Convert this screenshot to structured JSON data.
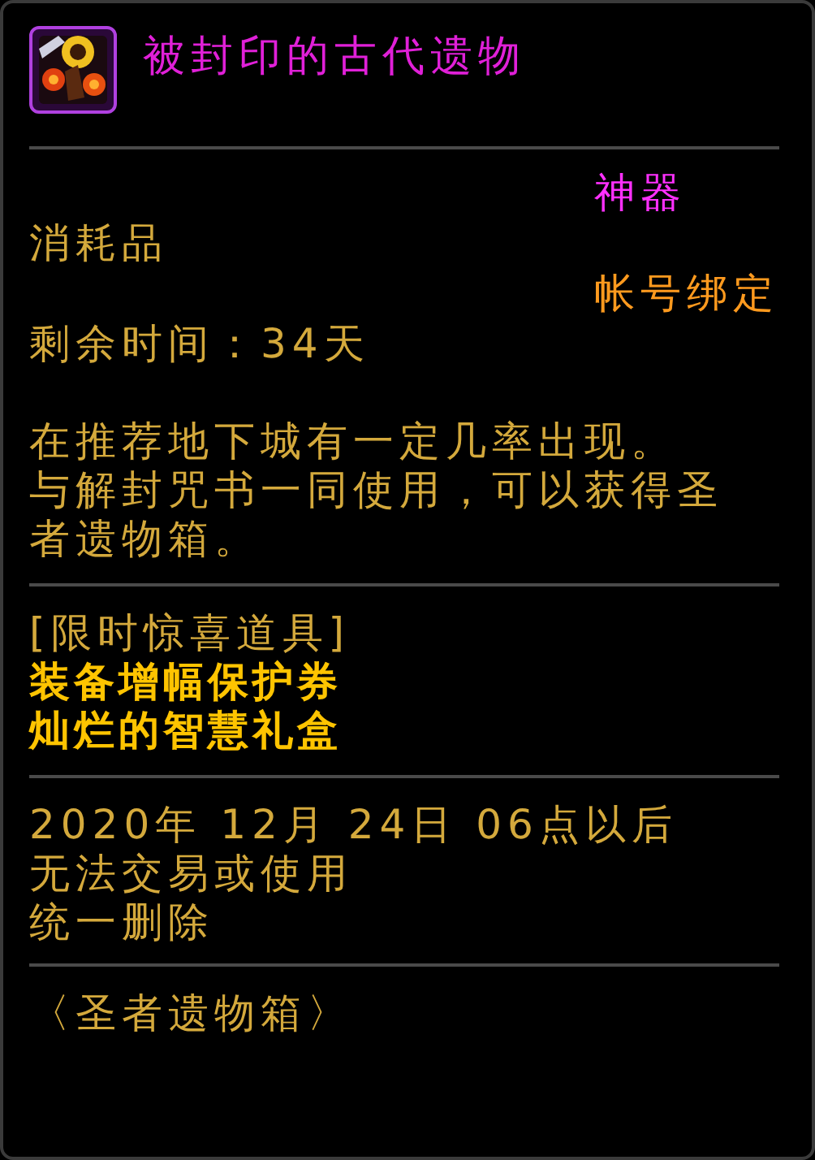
{
  "item": {
    "name": "被封印的古代遗物",
    "rarity": "神器",
    "type": "消耗品",
    "binding": "帐号绑定",
    "remaining_time": "剩余时间：34天",
    "description": [
      "在推荐地下城有一定几率出现。",
      "与解封咒书一同使用，可以获得圣",
      "者遗物箱。"
    ],
    "surprise_label": "[限时惊喜道具]",
    "surprise_items": [
      "装备增幅保护券",
      "灿烂的智慧礼盒"
    ],
    "expiry_lines": [
      "2020年 12月 24日 06点以后",
      "无法交易或使用",
      "统一删除"
    ],
    "set_name": "〈圣者遗物箱〉"
  }
}
